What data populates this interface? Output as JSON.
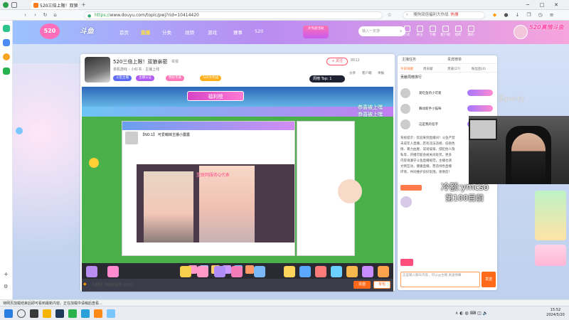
{
  "browser": {
    "tab_title": "520三倍上限！双狼亲密",
    "url_prefix": "https://",
    "url_rest": "www.douyu.com/topic/pwj?rid=10414420",
    "search_placeholder": "搜狗双倍福利大作战",
    "search_hot": "热搜"
  },
  "header": {
    "logo": "斗鱼",
    "nav": [
      "首页",
      "直播",
      "分类",
      "视频",
      "游戏",
      "赛事",
      "520"
    ],
    "badge": "大作战活动",
    "search_placeholder": "输入一定游",
    "icons": [
      "历史",
      "关注",
      "下载",
      "客户端",
      "福利",
      "我的"
    ],
    "brand": "520真情斗鱼"
  },
  "room": {
    "title": "520三倍上限！双狼亲密",
    "tag": "举报",
    "meta": "单机游戏 › 小红书 · 主播上线",
    "pills": [
      "斗鱼主播",
      "主播认证",
      "特权专属",
      "520大作战"
    ],
    "follow": "+ 关注",
    "fans": "8612",
    "rank": "周榜 Top: 1",
    "opts": [
      "分享",
      "客户端",
      "举报"
    ]
  },
  "video": {
    "badge": "福利榜",
    "inner_title": "【NO.1】 可爱萌妹主播小露露",
    "overlay": "互联网服务Q代表",
    "green": [
      "恭喜被上嘿",
      "恭喜被上嘿"
    ]
  },
  "idle": {
    "text": "【通知】你有新福利 1950",
    "recharge": "充值",
    "bag": "背包"
  },
  "rpanel": {
    "tabs": [
      "主播任务",
      "贵宾榜单"
    ],
    "subs": [
      "今日贡献",
      "周贡献",
      "贵族(27)",
      "粉丝团(4)"
    ],
    "rank_title": "贡献周榜排行",
    "rows": [
      "爱吃鱼的小可爱",
      "舞动新手小猫咪",
      "这是我的名字"
    ],
    "chat": [
      "系统提示：欢迎来到直播间！斗鱼严禁",
      "未成年人直播，若有违法违规、低俗色",
      "情、暴力血腥、诽谤诋毁、侵犯他人隐",
      "私等，开播可能会被关闭处罚，更多",
      "内容请遵守斗鱼直播规范，主播也请",
      "文明互动，健康直播，营造绿色直播",
      "环境，共同维护良好氛围。谢谢您！"
    ],
    "input_placeholder": "这里输入聊天内容，可以@主播 发送弹幕",
    "send": "发送"
  },
  "cam": {
    "caption1": "冷额:ymcso",
    "caption2": "第100目前",
    "watermark": "乐pw:ty"
  },
  "status": "待网页加载结束后即可看到最新内容。正在加载中请稍后查看...",
  "clock": [
    "15:52",
    "2024/5/20"
  ]
}
